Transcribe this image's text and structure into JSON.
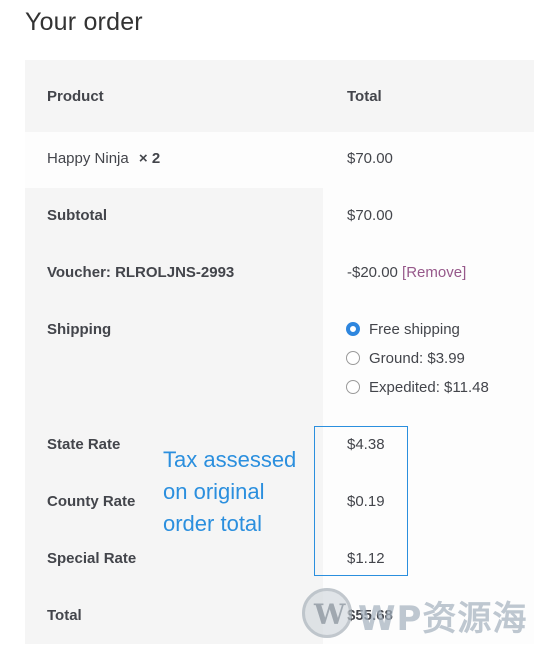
{
  "heading": "Your order",
  "table": {
    "header": {
      "product": "Product",
      "total": "Total"
    },
    "product_row": {
      "name": "Happy Ninja",
      "qty": "× 2",
      "total": "$70.00"
    },
    "subtotal": {
      "label": "Subtotal",
      "value": "$70.00"
    },
    "voucher": {
      "label": "Voucher: RLROLJNS-2993",
      "value": "-$20.00",
      "remove": "[Remove]"
    },
    "shipping": {
      "label": "Shipping",
      "options": [
        {
          "label": "Free shipping",
          "selected": true
        },
        {
          "label": "Ground: $3.99",
          "selected": false
        },
        {
          "label": "Expedited: $11.48",
          "selected": false
        }
      ]
    },
    "state_rate": {
      "label": "State Rate",
      "value": "$4.38"
    },
    "county_rate": {
      "label": "County Rate",
      "value": "$0.19"
    },
    "special_rate": {
      "label": "Special Rate",
      "value": "$1.12"
    },
    "total": {
      "label": "Total",
      "value": "$55.68"
    }
  },
  "annotation": {
    "line1": "Tax assessed",
    "line2": "on original",
    "line3": "order total"
  },
  "watermark": {
    "logo_letter": "W",
    "text": "WP资源海"
  },
  "colors": {
    "accent_blue": "#2b8fde",
    "link_purple": "#96588a",
    "radio_selected": "#2e86de"
  }
}
